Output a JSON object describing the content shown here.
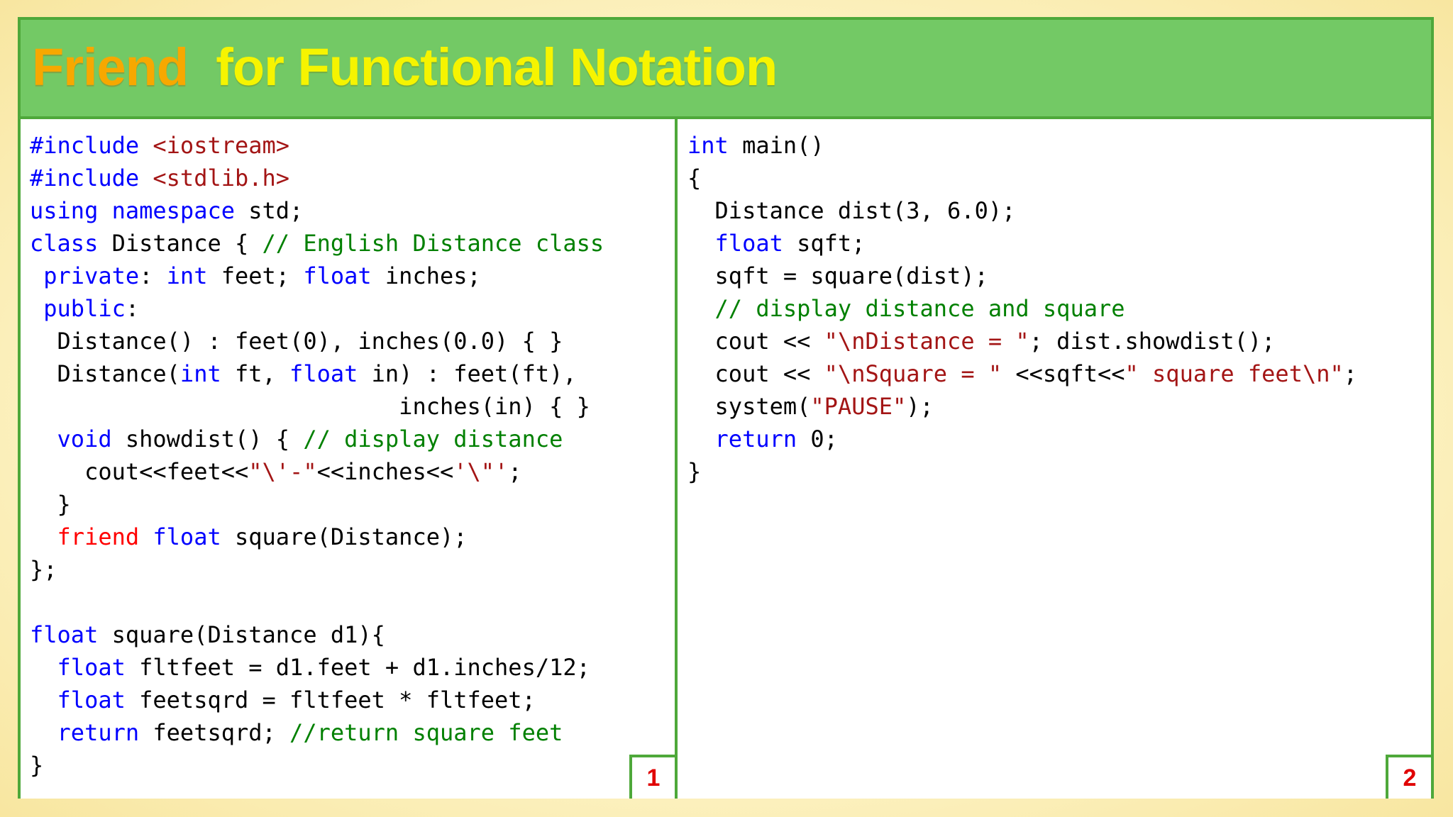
{
  "title": {
    "part1": "Friend",
    "part2": "for Functional Notation"
  },
  "colors": {
    "keyword": "#0000ff",
    "string": "#a31515",
    "comment": "#008000",
    "friend": "#ff0000",
    "title_bar": "#73c965",
    "border": "#4ea83a",
    "title_part1": "#f7a800",
    "title_part2": "#f6f400",
    "page_number": "#e00000"
  },
  "panels": [
    {
      "page_number": "1",
      "lines": [
        [
          [
            "k",
            "#include"
          ],
          [
            "p",
            " "
          ],
          [
            "s",
            "<iostream>"
          ]
        ],
        [
          [
            "k",
            "#include"
          ],
          [
            "p",
            " "
          ],
          [
            "s",
            "<stdlib.h>"
          ]
        ],
        [
          [
            "k",
            "using"
          ],
          [
            "p",
            " "
          ],
          [
            "k",
            "namespace"
          ],
          [
            "p",
            " std;"
          ]
        ],
        [
          [
            "k",
            "class"
          ],
          [
            "p",
            " Distance { "
          ],
          [
            "c",
            "// English Distance class"
          ]
        ],
        [
          [
            "p",
            " "
          ],
          [
            "k",
            "private"
          ],
          [
            "p",
            ": "
          ],
          [
            "k",
            "int"
          ],
          [
            "p",
            " feet; "
          ],
          [
            "k",
            "float"
          ],
          [
            "p",
            " inches;"
          ]
        ],
        [
          [
            "p",
            " "
          ],
          [
            "k",
            "public"
          ],
          [
            "p",
            ":"
          ]
        ],
        [
          [
            "p",
            "  Distance() : feet(0), inches(0.0) { }"
          ]
        ],
        [
          [
            "p",
            "  Distance("
          ],
          [
            "k",
            "int"
          ],
          [
            "p",
            " ft, "
          ],
          [
            "k",
            "float"
          ],
          [
            "p",
            " in) : feet(ft),"
          ]
        ],
        [
          [
            "p",
            "                           inches(in) { }"
          ]
        ],
        [
          [
            "p",
            "  "
          ],
          [
            "k",
            "void"
          ],
          [
            "p",
            " showdist() { "
          ],
          [
            "c",
            "// display distance"
          ]
        ],
        [
          [
            "p",
            "    cout<<feet<<"
          ],
          [
            "s",
            "\"\\'-\""
          ],
          [
            "p",
            "<<inches<<"
          ],
          [
            "s",
            "'\\\"'"
          ],
          [
            "p",
            ";"
          ]
        ],
        [
          [
            "p",
            "  }"
          ]
        ],
        [
          [
            "p",
            "  "
          ],
          [
            "r",
            "friend"
          ],
          [
            "p",
            " "
          ],
          [
            "k",
            "float"
          ],
          [
            "p",
            " square(Distance);"
          ]
        ],
        [
          [
            "p",
            "};"
          ]
        ],
        [
          [
            "p",
            ""
          ]
        ],
        [
          [
            "k",
            "float"
          ],
          [
            "p",
            " square(Distance d1){"
          ]
        ],
        [
          [
            "p",
            "  "
          ],
          [
            "k",
            "float"
          ],
          [
            "p",
            " fltfeet = d1.feet + d1.inches/12;"
          ]
        ],
        [
          [
            "p",
            "  "
          ],
          [
            "k",
            "float"
          ],
          [
            "p",
            " feetsqrd = fltfeet * fltfeet;"
          ]
        ],
        [
          [
            "p",
            "  "
          ],
          [
            "k",
            "return"
          ],
          [
            "p",
            " feetsqrd; "
          ],
          [
            "c",
            "//return square feet"
          ]
        ],
        [
          [
            "p",
            "}"
          ]
        ]
      ]
    },
    {
      "page_number": "2",
      "lines": [
        [
          [
            "k",
            "int"
          ],
          [
            "p",
            " main()"
          ]
        ],
        [
          [
            "p",
            "{"
          ]
        ],
        [
          [
            "p",
            "  Distance dist(3, 6.0);"
          ]
        ],
        [
          [
            "p",
            "  "
          ],
          [
            "k",
            "float"
          ],
          [
            "p",
            " sqft;"
          ]
        ],
        [
          [
            "p",
            "  sqft = square(dist);"
          ]
        ],
        [
          [
            "p",
            "  "
          ],
          [
            "c",
            "// display distance and square"
          ]
        ],
        [
          [
            "p",
            "  cout << "
          ],
          [
            "s",
            "\"\\nDistance = \""
          ],
          [
            "p",
            "; dist.showdist();"
          ]
        ],
        [
          [
            "p",
            "  cout << "
          ],
          [
            "s",
            "\"\\nSquare = \""
          ],
          [
            "p",
            " <<sqft<<"
          ],
          [
            "s",
            "\" square feet\\n\""
          ],
          [
            "p",
            ";"
          ]
        ],
        [
          [
            "p",
            "  system("
          ],
          [
            "s",
            "\"PAUSE\""
          ],
          [
            "p",
            ");"
          ]
        ],
        [
          [
            "p",
            "  "
          ],
          [
            "k",
            "return"
          ],
          [
            "p",
            " 0;"
          ]
        ],
        [
          [
            "p",
            "}"
          ]
        ]
      ]
    }
  ]
}
